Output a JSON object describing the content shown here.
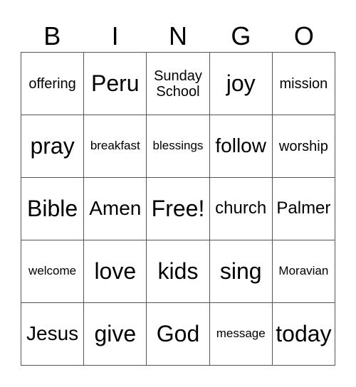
{
  "header": [
    "B",
    "I",
    "N",
    "G",
    "O"
  ],
  "cells": [
    [
      "offering",
      "Peru",
      "Sunday School",
      "joy",
      "mission"
    ],
    [
      "pray",
      "breakfast",
      "blessings",
      "follow",
      "worship"
    ],
    [
      "Bible",
      "Amen",
      "Free!",
      "church",
      "Palmer"
    ],
    [
      "welcome",
      "love",
      "kids",
      "sing",
      "Moravian"
    ],
    [
      "Jesus",
      "give",
      "God",
      "message",
      "today"
    ]
  ]
}
